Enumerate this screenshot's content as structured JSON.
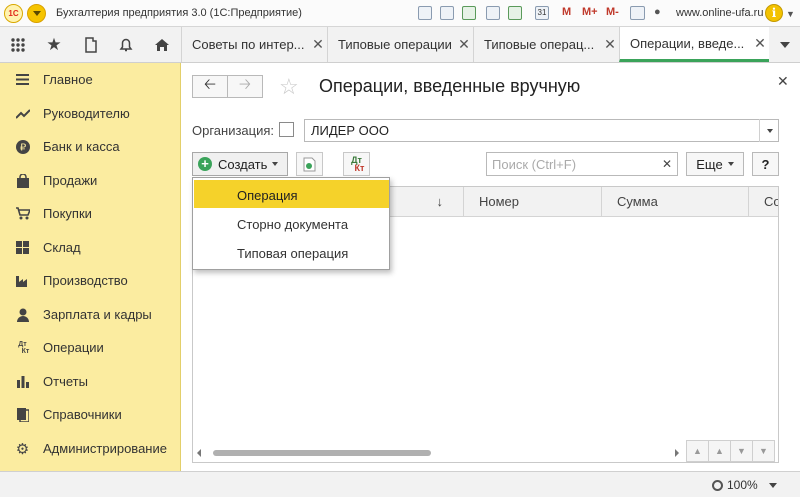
{
  "titlebar": {
    "app_title": "Бухгалтерия предприятия 3.0  (1С:Предприятие)",
    "logo_text": "1С",
    "m_labels": [
      "M",
      "M+",
      "M-"
    ],
    "site": "www.online-ufa.ru",
    "calendar_day": "31"
  },
  "tabs": [
    {
      "label": "Советы по интер..."
    },
    {
      "label": "Типовые операции"
    },
    {
      "label": "Типовые операц..."
    },
    {
      "label": "Операции, введе..."
    }
  ],
  "sidebar": {
    "items": [
      {
        "label": "Главное",
        "icon": "hamburger-icon"
      },
      {
        "label": "Руководителю",
        "icon": "trend-icon"
      },
      {
        "label": "Банк и касса",
        "icon": "ruble-coin-icon"
      },
      {
        "label": "Продажи",
        "icon": "shopping-bag-icon"
      },
      {
        "label": "Покупки",
        "icon": "cart-icon"
      },
      {
        "label": "Склад",
        "icon": "grid-icon"
      },
      {
        "label": "Производство",
        "icon": "factory-icon"
      },
      {
        "label": "Зарплата и кадры",
        "icon": "person-icon"
      },
      {
        "label": "Операции",
        "icon": "dt-kt-icon"
      },
      {
        "label": "Отчеты",
        "icon": "bar-chart-icon"
      },
      {
        "label": "Справочники",
        "icon": "books-icon"
      },
      {
        "label": "Администрирование",
        "icon": "gear-icon"
      }
    ]
  },
  "main": {
    "title": "Операции, введенные вручную",
    "org_label": "Организация:",
    "org_value": "ЛИДЕР ООО",
    "create_label": "Создать",
    "dtkt_top": "Дт",
    "dtkt_bottom": "Кт",
    "search_placeholder": "Поиск (Ctrl+F)",
    "more_label": "Еще",
    "help_label": "?",
    "columns": [
      "↓",
      "Номер",
      "Сумма",
      "Со"
    ]
  },
  "dropdown": {
    "items": [
      "Операция",
      "Сторно документа",
      "Типовая операция"
    ],
    "highlighted": 0
  },
  "statusbar": {
    "zoom": "100%"
  },
  "colors": {
    "sidebar_bg": "#fbeca0",
    "highlight": "#f5d22a",
    "accent_green": "#3aa35a"
  }
}
